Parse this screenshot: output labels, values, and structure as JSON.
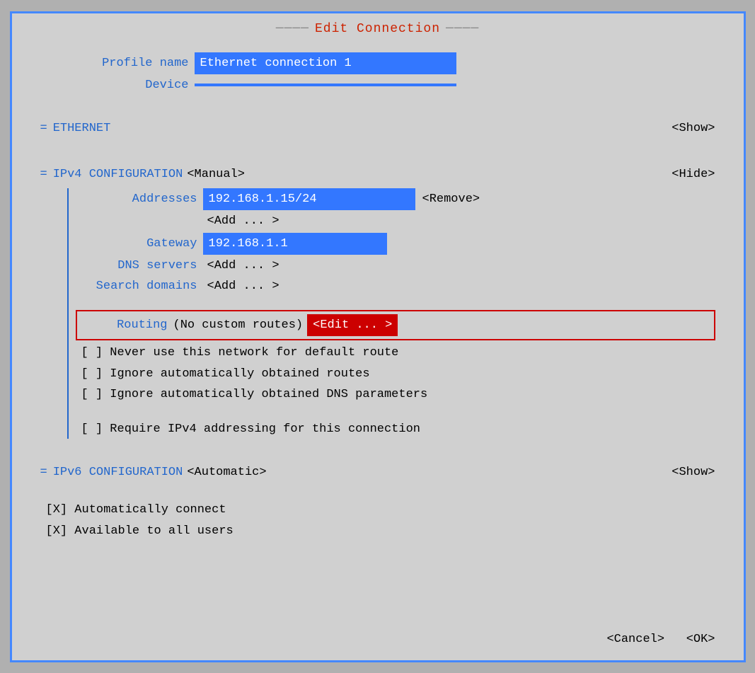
{
  "window": {
    "title": "Edit Connection"
  },
  "profile": {
    "label": "Profile name",
    "value": "Ethernet connection 1"
  },
  "device": {
    "label": "Device",
    "value": ""
  },
  "ethernet": {
    "section": "ETHERNET",
    "action": "<Show>"
  },
  "ipv4": {
    "section": "IPv4 CONFIGURATION",
    "mode": "<Manual>",
    "action": "<Hide>",
    "addresses_label": "Addresses",
    "addresses_value": "192.168.1.15/24",
    "addresses_remove": "<Remove>",
    "add1": "<Add ... >",
    "gateway_label": "Gateway",
    "gateway_value": "192.168.1.1",
    "dns_label": "DNS servers",
    "dns_add": "<Add ... >",
    "search_label": "Search domains",
    "search_add": "<Add ... >",
    "routing_label": "Routing",
    "routing_text": "(No custom routes)",
    "routing_edit": "<Edit ... >",
    "checkbox1": "[ ] Never use this network for default route",
    "checkbox2": "[ ] Ignore automatically obtained routes",
    "checkbox3": "[ ] Ignore automatically obtained DNS parameters",
    "checkbox4": "[ ] Require IPv4 addressing for this connection"
  },
  "ipv6": {
    "section": "IPv6 CONFIGURATION",
    "mode": "<Automatic>",
    "action": "<Show>"
  },
  "auto_connect": "[X] Automatically connect",
  "available_users": "[X] Available to all users",
  "cancel": "<Cancel>",
  "ok": "<OK>"
}
